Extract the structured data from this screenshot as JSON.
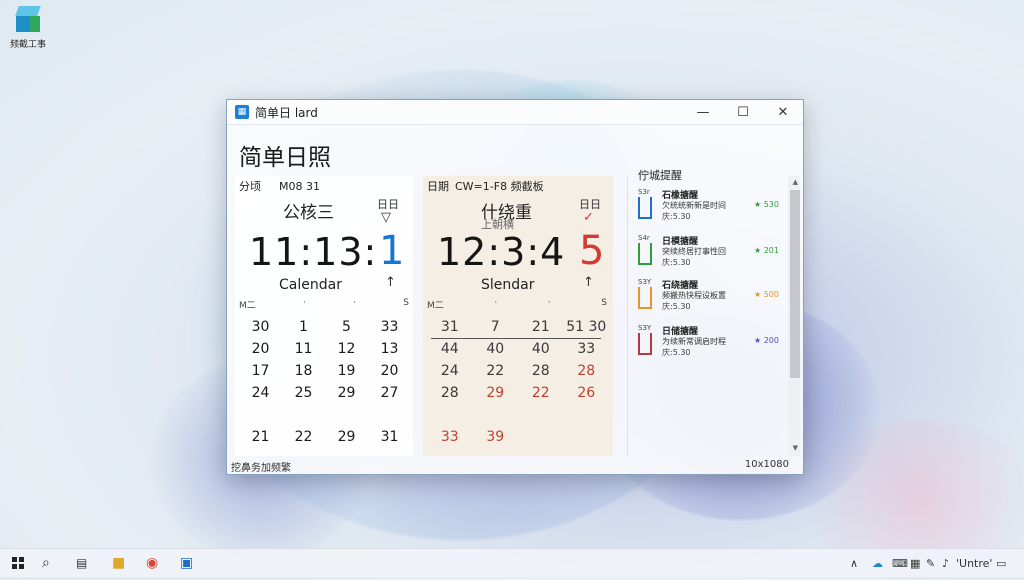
{
  "desktop": {
    "icon_label": "频截工事"
  },
  "window": {
    "title": "简单日 lard",
    "controls": {
      "minimize": "—",
      "maximize": "☐",
      "close": "✕"
    },
    "app_title": "简单日照"
  },
  "panel_left": {
    "header_a": "分顷",
    "header_b": "M08 31",
    "weekday_large": "公核三",
    "weekday_small": "日日",
    "mark": "▽",
    "time": "11:13:",
    "big": "1",
    "label": "Calendar",
    "arrow": "↑",
    "dow": [
      "M二",
      "·",
      "·",
      "S"
    ],
    "rows": [
      [
        "30",
        "1",
        "5",
        "33"
      ],
      [
        "20",
        "11",
        "12",
        "13"
      ],
      [
        "17",
        "18",
        "19",
        "20"
      ],
      [
        "24",
        "25",
        "29",
        "27"
      ],
      [
        "21",
        "22",
        "29",
        "31"
      ]
    ]
  },
  "panel_mid": {
    "header_a": "日期",
    "header_b": "CW=1-F8 频截板",
    "weekday_large": "什绕重",
    "sub": "上朝横",
    "weekday_small": "日日",
    "mark": "✓",
    "time": "12:3:4",
    "big": "5",
    "label": "Slendar",
    "arrow": "↑",
    "dow": [
      "M二",
      "·",
      "·",
      "S"
    ],
    "rows": [
      [
        "31",
        "7",
        "21",
        "51 30"
      ],
      [
        "44",
        "40",
        "40",
        "33"
      ],
      [
        "24",
        "22",
        "28",
        "28"
      ],
      [
        "28",
        "29",
        "22",
        "26"
      ],
      [
        "33",
        "39",
        "",
        ""
      ]
    ]
  },
  "tasks": {
    "header": "佇城提醒",
    "items": [
      {
        "num": "S3r",
        "title": "石橡搪醒",
        "desc": "欠统统新新是时间",
        "meta": "庆:5.30",
        "star": "★ 530",
        "color": "#1f6fd1",
        "star_color": "#2f9d3a"
      },
      {
        "num": "S4r",
        "title": "日模搪醒",
        "desc": "突续终居打事性回",
        "meta": "庆:5.30",
        "star": "★ 201",
        "color": "#2f9d3a",
        "star_color": "#2f9d3a"
      },
      {
        "num": "S3Y",
        "title": "石绕搪醒",
        "desc": "频搬热快程设板置",
        "meta": "庆:5.30",
        "star": "★ 500",
        "color": "#e3962a",
        "star_color": "#e3962a"
      },
      {
        "num": "S3Y",
        "title": "日储搪醒",
        "desc": "为续新常调启时程",
        "meta": "庆:5.30",
        "star": "★ 200",
        "color": "#b23b44",
        "star_color": "#4a55c0"
      }
    ]
  },
  "status": {
    "left": "挖鼻务加频繁",
    "right": "10x1080"
  },
  "taskbar": {
    "icons": [
      "windows-icon",
      "search-icon",
      "task-view-icon",
      "folder-icon",
      "chrome-icon",
      "store-icon"
    ],
    "tray": {
      "chevron": "∧",
      "text": "'Untre'"
    }
  }
}
